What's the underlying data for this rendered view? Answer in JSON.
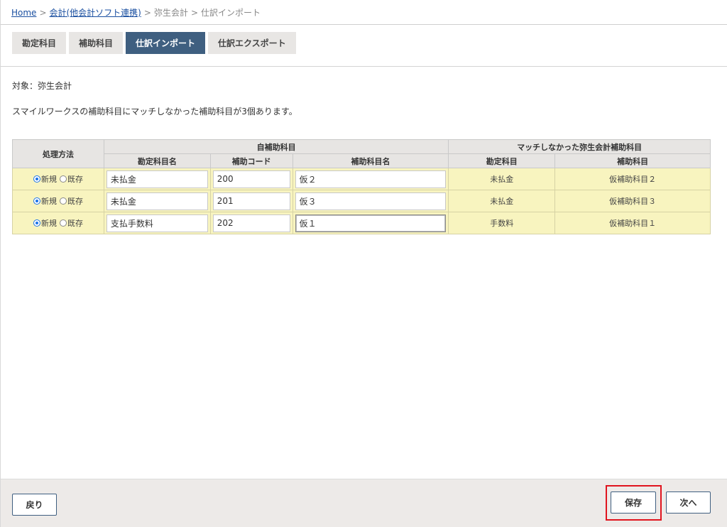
{
  "breadcrumb": {
    "home": "Home",
    "sep": ">",
    "accounting": "会計(他会計ソフト連携)",
    "yayoi": "弥生会計",
    "current": "仕訳インポート"
  },
  "tabs": [
    {
      "label": "勘定科目"
    },
    {
      "label": "補助科目"
    },
    {
      "label": "仕訳インポート"
    },
    {
      "label": "仕訳エクスポート"
    }
  ],
  "target_text": "対象：弥生会計",
  "message_text": "スマイルワークスの補助科目にマッチしなかった補助科目が3個あります。",
  "table": {
    "header_method": "処理方法",
    "header_own": "自補助科目",
    "header_unmatched": "マッチしなかった弥生会計補助科目",
    "col_account_name": "勘定科目名",
    "col_sub_code": "補助コード",
    "col_sub_name": "補助科目名",
    "col_account": "勘定科目",
    "col_sub": "補助科目",
    "radio_new": "新規",
    "radio_existing": "既存",
    "rows": [
      {
        "account_name": "未払金",
        "code": "200",
        "sub_name": "仮２",
        "yayoi_account": "未払金",
        "yayoi_sub": "仮補助科目２"
      },
      {
        "account_name": "未払金",
        "code": "201",
        "sub_name": "仮３",
        "yayoi_account": "未払金",
        "yayoi_sub": "仮補助科目３"
      },
      {
        "account_name": "支払手数料",
        "code": "202",
        "sub_name": "仮１",
        "yayoi_account": "手数料",
        "yayoi_sub": "仮補助科目１"
      }
    ]
  },
  "footer": {
    "back_label": "戻り",
    "save_label": "保存",
    "next_label": "次へ"
  },
  "colors": {
    "tab_active": "#3f5f80",
    "row_bg": "#f8f4bf",
    "highlight": "#e0141e",
    "link": "#1a4fa0"
  }
}
